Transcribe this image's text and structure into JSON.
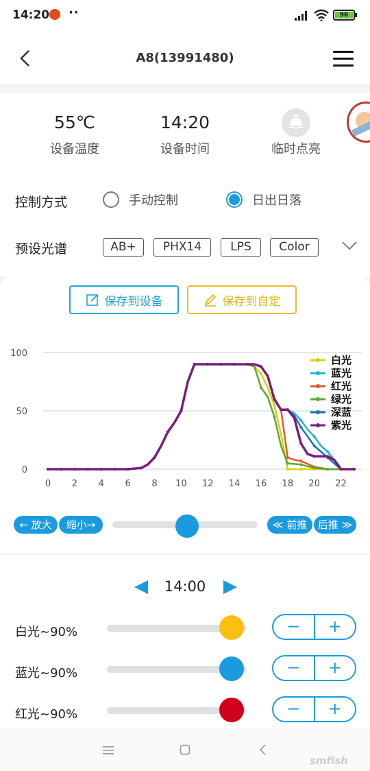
{
  "status_bar": {
    "time": "14:20",
    "more": "··",
    "battery": "96"
  },
  "header": {
    "title": "A8(13991480)"
  },
  "stats": [
    {
      "value": "55℃",
      "label": "设备温度"
    },
    {
      "value": "14:20",
      "label": "设备时间"
    },
    {
      "value": "",
      "label": "临时点亮"
    }
  ],
  "control": {
    "label": "控制方式",
    "options": [
      {
        "label": "手动控制",
        "selected": false
      },
      {
        "label": "日出日落",
        "selected": true
      }
    ]
  },
  "presets": {
    "label": "预设光谱",
    "chips": [
      "AB+",
      "PHX14",
      "LPS",
      "Color"
    ]
  },
  "actions": {
    "save_device": "保存到设备",
    "save_custom": "保存到自定"
  },
  "zoom": {
    "zoom_in": "← 放大",
    "zoom_out": "缩小→",
    "forward": "≪ 前推",
    "backward": "后推 ≫",
    "slider_position": 0.5
  },
  "chart_data": {
    "type": "line",
    "x_ticks": [
      "0",
      "2",
      "4",
      "6",
      "8",
      "10",
      "12",
      "14",
      "16",
      "18",
      "20",
      "22"
    ],
    "y_ticks": [
      "100",
      "50",
      "0"
    ],
    "xlim": [
      0,
      23
    ],
    "ylim": [
      0,
      100
    ],
    "grid": true,
    "legend_position": "top-right",
    "series": [
      {
        "name": "白光",
        "color": "#d4d400",
        "x": [
          0,
          1,
          2,
          3,
          4,
          5,
          6,
          7,
          7.5,
          8,
          8.5,
          9,
          9.5,
          10,
          10.5,
          11,
          12,
          13,
          14,
          15,
          15.5,
          16,
          16.5,
          17,
          17.5,
          18,
          19,
          20,
          21,
          22,
          23
        ],
        "y": [
          0,
          0,
          0,
          0,
          0,
          0,
          0,
          1,
          4,
          10,
          20,
          32,
          40,
          50,
          75,
          90,
          90,
          90,
          90,
          90,
          88,
          82,
          70,
          55,
          30,
          0,
          0,
          0,
          0,
          0,
          0
        ]
      },
      {
        "name": "蓝光",
        "color": "#1fb5d8",
        "x": [
          0,
          1,
          2,
          3,
          4,
          5,
          6,
          7,
          7.5,
          8,
          8.5,
          9,
          9.5,
          10,
          10.5,
          11,
          12,
          13,
          14,
          15,
          15.5,
          16,
          16.5,
          17,
          17.5,
          18,
          18.5,
          19,
          19.5,
          20,
          20.5,
          21,
          21.5,
          22,
          23
        ],
        "y": [
          0,
          0,
          0,
          0,
          0,
          0,
          0,
          1,
          4,
          10,
          20,
          32,
          40,
          50,
          75,
          90,
          90,
          90,
          90,
          90,
          90,
          88,
          80,
          60,
          51,
          51,
          48,
          42,
          34,
          28,
          20,
          15,
          8,
          0,
          0
        ]
      },
      {
        "name": "红光",
        "color": "#e8552b",
        "x": [
          0,
          1,
          2,
          3,
          4,
          5,
          6,
          7,
          7.5,
          8,
          8.5,
          9,
          9.5,
          10,
          10.5,
          11,
          12,
          13,
          14,
          15,
          15.5,
          16,
          16.5,
          17,
          17.5,
          18,
          18.5,
          19,
          20,
          21,
          22,
          23
        ],
        "y": [
          0,
          0,
          0,
          0,
          0,
          0,
          0,
          1,
          4,
          10,
          20,
          32,
          40,
          50,
          75,
          90,
          90,
          90,
          90,
          90,
          90,
          88,
          80,
          60,
          51,
          10,
          8,
          7,
          2,
          0,
          0,
          0
        ]
      },
      {
        "name": "绿光",
        "color": "#5aab2e",
        "x": [
          0,
          1,
          2,
          3,
          4,
          5,
          6,
          7,
          7.5,
          8,
          8.5,
          9,
          9.5,
          10,
          10.5,
          11,
          12,
          13,
          14,
          15,
          15.5,
          16,
          16.5,
          17,
          17.5,
          18,
          19,
          20,
          21,
          22,
          23
        ],
        "y": [
          0,
          0,
          0,
          0,
          0,
          0,
          0,
          1,
          4,
          10,
          20,
          32,
          40,
          50,
          75,
          90,
          90,
          90,
          90,
          90,
          88,
          70,
          62,
          45,
          20,
          5,
          4,
          1,
          0,
          0,
          0
        ]
      },
      {
        "name": "深蓝",
        "color": "#1774b8",
        "x": [
          0,
          1,
          2,
          3,
          4,
          5,
          6,
          7,
          7.5,
          8,
          8.5,
          9,
          9.5,
          10,
          10.5,
          11,
          12,
          13,
          14,
          15,
          15.5,
          16,
          16.5,
          17,
          17.5,
          18,
          18.5,
          19,
          19.5,
          20,
          20.5,
          21,
          21.5,
          22,
          23
        ],
        "y": [
          0,
          0,
          0,
          0,
          0,
          0,
          0,
          1,
          4,
          10,
          20,
          32,
          40,
          50,
          75,
          90,
          90,
          90,
          90,
          90,
          90,
          88,
          80,
          60,
          51,
          51,
          46,
          36,
          28,
          20,
          15,
          10,
          5,
          0,
          0
        ]
      },
      {
        "name": "紫光",
        "color": "#7b1a82",
        "x": [
          0,
          1,
          2,
          3,
          4,
          5,
          6,
          7,
          7.5,
          8,
          8.5,
          9,
          9.5,
          10,
          10.5,
          11,
          12,
          13,
          14,
          15,
          15.5,
          16,
          16.5,
          17,
          17.5,
          18,
          18.5,
          19,
          19.5,
          20,
          20.5,
          21,
          21.5,
          22,
          23
        ],
        "y": [
          0,
          0,
          0,
          0,
          0,
          0,
          0,
          1,
          4,
          10,
          20,
          32,
          40,
          50,
          75,
          90,
          90,
          90,
          90,
          90,
          90,
          88,
          80,
          60,
          51,
          51,
          44,
          22,
          13,
          11,
          11,
          11,
          8,
          0,
          0
        ]
      }
    ]
  },
  "time_nav": {
    "prev": "◀",
    "time": "14:00",
    "next": "▶"
  },
  "channels": [
    {
      "label": "白光~90%",
      "value": 90,
      "color": "#fbbf10"
    },
    {
      "label": "蓝光~90%",
      "value": 90,
      "color": "#1a9be0"
    },
    {
      "label": "红光~90%",
      "value": 90,
      "color": "#d0021b"
    }
  ],
  "stepper": {
    "minus": "−",
    "plus": "+"
  },
  "watermark": "smfish"
}
